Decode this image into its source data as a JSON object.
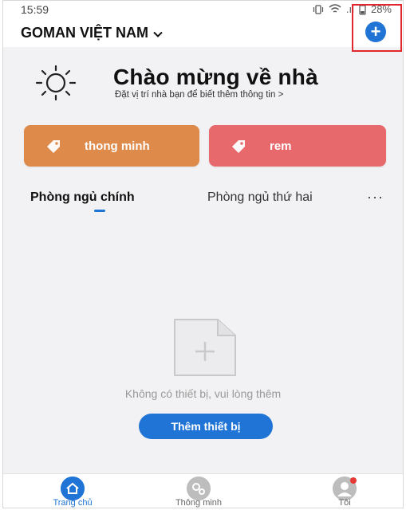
{
  "status_bar": {
    "time": "15:59",
    "signal_text": ".ıl",
    "battery": "28%"
  },
  "header": {
    "home_name": "GOMAN VIỆT NAM",
    "dropdown_icon": "chevron-down-icon",
    "add_button_icon": "plus-circle-icon",
    "add_button_glyph": "+"
  },
  "welcome": {
    "title": "Chào mừng về nhà",
    "subtitle": "Đặt vị trí nhà bạn để biết thêm thông tin >",
    "icon": "sun-icon"
  },
  "scenes": [
    {
      "label": "thong minh",
      "icon": "tag-icon",
      "color": "#de8a4a"
    },
    {
      "label": "rem",
      "icon": "tag-icon",
      "color": "#e8696b"
    }
  ],
  "rooms": {
    "tabs": [
      {
        "label": "Phòng ngủ chính",
        "active": true
      },
      {
        "label": "Phòng ngủ thứ hai",
        "active": false
      }
    ],
    "more_label": "···"
  },
  "empty_state": {
    "icon": "empty-device-icon",
    "message": "Không có thiết bị, vui lòng thêm",
    "button_label": "Thêm thiết bị"
  },
  "bottom_nav": {
    "items": [
      {
        "label": "Trang chủ",
        "icon": "home-icon",
        "active": true
      },
      {
        "label": "Thông minh",
        "icon": "smart-gears-icon",
        "active": false
      },
      {
        "label": "Tôi",
        "icon": "profile-icon",
        "active": false
      }
    ]
  },
  "colors": {
    "accent": "#1f74d6",
    "highlight_box": "#e0282d",
    "notification_dot": "#e53935"
  }
}
